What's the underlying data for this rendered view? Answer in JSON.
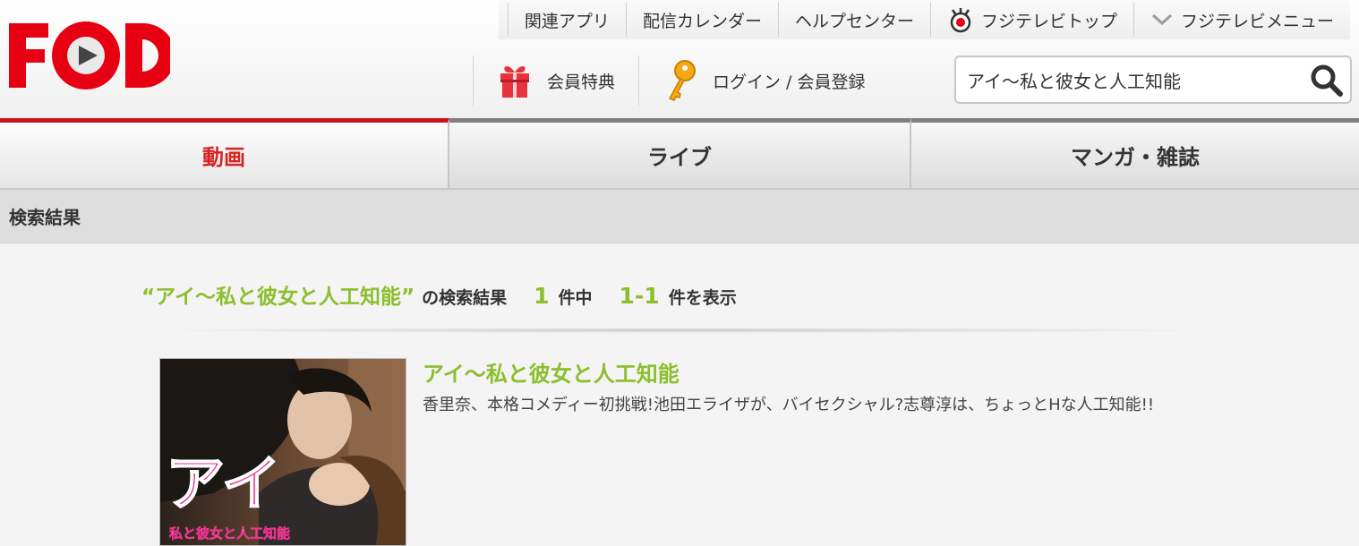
{
  "brand": {
    "logo_text": "FOD",
    "logo_color": "#e60012"
  },
  "topnav": [
    {
      "label": "関連アプリ"
    },
    {
      "label": "配信カレンダー"
    },
    {
      "label": "ヘルプセンター"
    },
    {
      "label": "フジテレビトップ",
      "icon": "fujitv-eye-icon"
    },
    {
      "label": "フジテレビメニュー",
      "icon": "chevron-down-icon"
    }
  ],
  "subnav": {
    "benefits_label": "会員特典",
    "login_label": "ログイン / 会員登録"
  },
  "search": {
    "value": "アイ〜私と彼女と人工知能",
    "icon": "search-icon"
  },
  "tabs": [
    {
      "label": "動画",
      "active": true
    },
    {
      "label": "ライブ",
      "active": false
    },
    {
      "label": "マンガ・雑誌",
      "active": false
    }
  ],
  "section_title": "検索結果",
  "summary": {
    "query": "“アイ〜私と彼女と人工知能”",
    "suffix": "の検索結果",
    "total": "1",
    "total_suffix": "件中",
    "range": "1-1",
    "range_suffix": "件を表示"
  },
  "results": [
    {
      "title": "アイ〜私と彼女と人工知能",
      "description": "香里奈、本格コメディー初挑戦!池田エライザが、バイセクシャル?志尊淳は、ちょっとHな人工知能!!",
      "thumb_title_art": "アイ",
      "thumb_subtitle_art": "私と彼女と人工知能"
    }
  ],
  "colors": {
    "accent_green": "#8cbe2d",
    "tab_active_red": "#c8141e"
  }
}
